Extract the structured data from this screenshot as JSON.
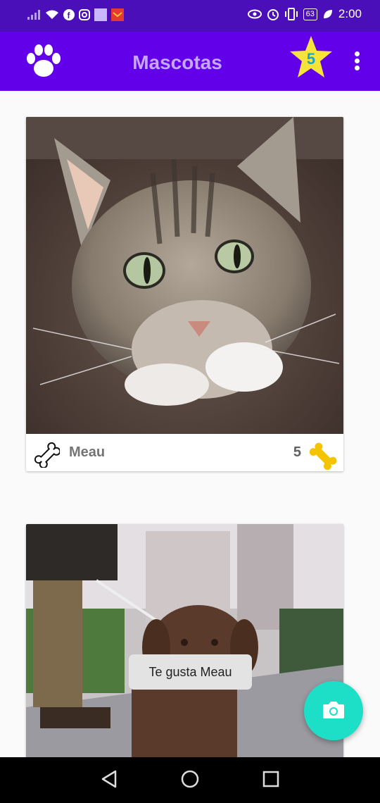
{
  "status_bar": {
    "time": "2:00",
    "battery": "63",
    "icons_left": [
      "signal-icon",
      "wifi-icon",
      "facebook-icon",
      "instagram-icon",
      "square-icon",
      "gift-icon"
    ],
    "icons_right": [
      "eye-icon",
      "alarm-icon",
      "vibrate-icon",
      "battery-icon",
      "leaf-icon"
    ]
  },
  "app_bar": {
    "title": "Mascotas",
    "star_count": "5",
    "colors": {
      "primary": "#6200ea",
      "status": "#4a0fb8",
      "title": "#c6a6ff",
      "star": "#f7e43a"
    }
  },
  "pets": [
    {
      "name": "Meau",
      "likes": "5",
      "photo": "cat"
    },
    {
      "name": "",
      "likes": "",
      "photo": "dog"
    }
  ],
  "toast": {
    "text": "Te gusta Meau"
  },
  "fab": {
    "icon": "camera-icon",
    "color": "#1ddfc8"
  },
  "nav": {
    "buttons": [
      "back-icon",
      "home-icon",
      "recents-icon"
    ]
  }
}
